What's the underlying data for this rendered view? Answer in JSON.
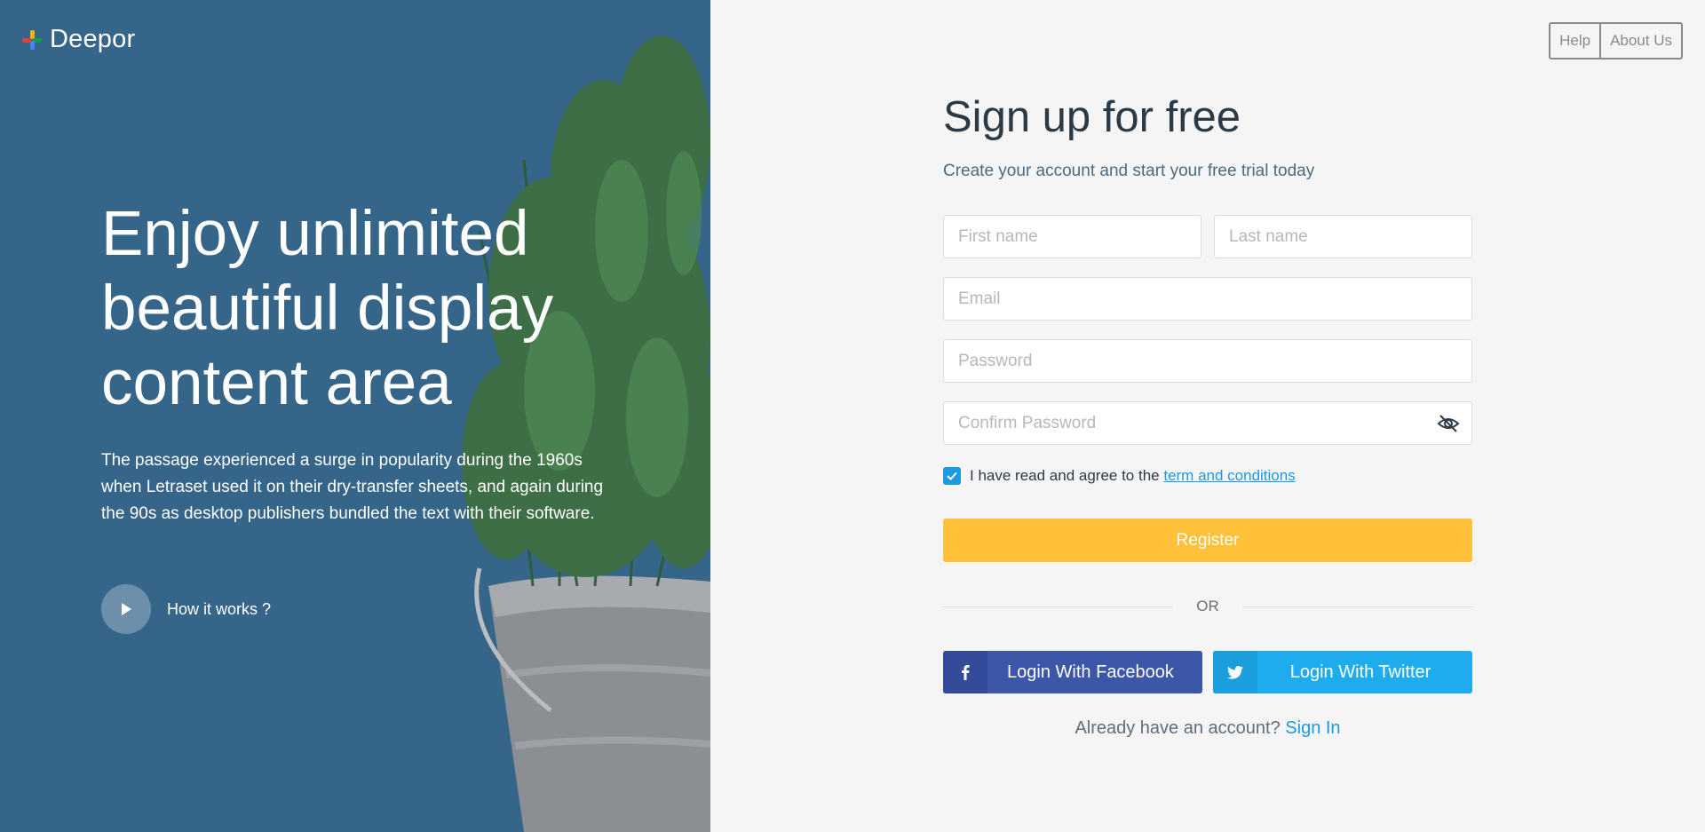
{
  "brand": {
    "name": "Deepor",
    "logo_icon": "pinwheel-logo-icon"
  },
  "hero": {
    "title_lines": [
      "Enjoy unlimited",
      "beautiful display",
      "content area"
    ],
    "text": "The passage experienced a surge in popularity during the 1960s when Letraset used it on their dry-transfer sheets, and again during the 90s as desktop publishers bundled the text with their software.",
    "how_label": "How it works ?",
    "play_icon": "play-icon"
  },
  "top_nav": {
    "help": "Help",
    "about": "About Us"
  },
  "form": {
    "title": "Sign up for free",
    "subtitle": "Create your account and start your free trial today",
    "first_name": {
      "placeholder": "First name",
      "value": ""
    },
    "last_name": {
      "placeholder": "Last name",
      "value": ""
    },
    "email": {
      "placeholder": "Email",
      "value": ""
    },
    "password": {
      "placeholder": "Password",
      "value": ""
    },
    "confirm_password": {
      "placeholder": "Confirm Password",
      "value": "",
      "toggle_icon": "eye-off-icon"
    },
    "agree_checked": true,
    "agree_text": "I have read and agree to the",
    "terms_link": "term and conditions",
    "register_label": "Register",
    "or_label": "OR",
    "facebook_label": "Login With Facebook",
    "twitter_label": "Login With Twitter",
    "signin_prompt": "Already have an account?",
    "signin_link": "Sign In"
  },
  "colors": {
    "left_bg": "#356589",
    "right_bg": "#f5f5f5",
    "register": "#ffc03a",
    "facebook": "#3c56a8",
    "twitter": "#1eacee",
    "link": "#1b9ae3"
  }
}
